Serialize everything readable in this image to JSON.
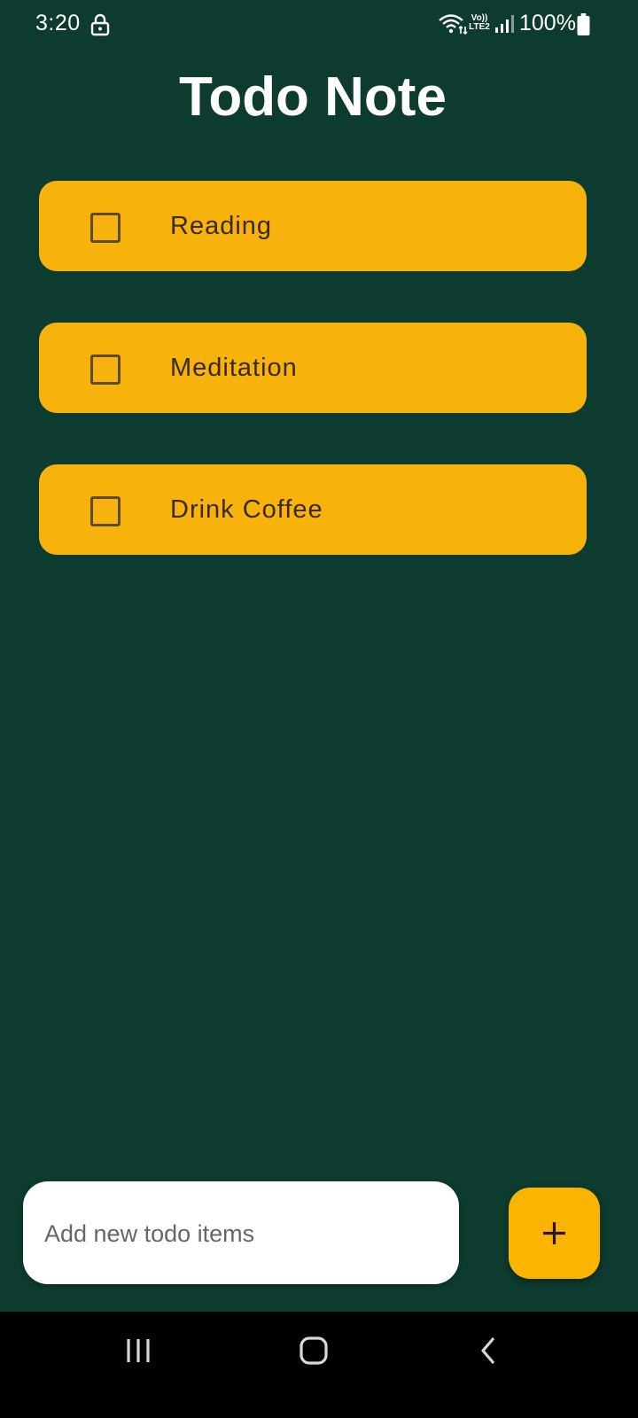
{
  "status_bar": {
    "time": "3:20",
    "network_label": "Vo)) LTE2",
    "battery": "100%",
    "icons": [
      "lock-icon",
      "wifi-icon",
      "signal-icon",
      "battery-icon"
    ]
  },
  "app": {
    "title": "Todo Note"
  },
  "todos": [
    {
      "label": "Reading",
      "checked": false
    },
    {
      "label": "Meditation",
      "checked": false
    },
    {
      "label": "Drink Coffee",
      "checked": false
    }
  ],
  "input": {
    "placeholder": "Add new todo items",
    "value": ""
  },
  "add_button": {
    "icon": "plus-icon"
  },
  "nav_bar": {
    "icons": [
      "recent-apps-icon",
      "home-icon",
      "back-icon"
    ]
  },
  "colors": {
    "background": "#0d3b2f",
    "item_background": "#f7b20b",
    "fab_background": "#fbb500",
    "input_background": "#ffffff"
  }
}
